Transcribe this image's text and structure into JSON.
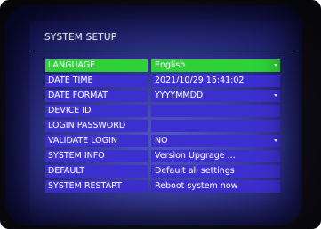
{
  "title": "SYSTEM SETUP",
  "colors": {
    "item_bg": "#3c2fd0",
    "active_bg": "#2fd236",
    "title_rule": "#a8e6df"
  },
  "rows": [
    {
      "label": "LANGUAGE",
      "value": "English",
      "dropdown": true,
      "active": true
    },
    {
      "label": "DATE TIME",
      "value": "2021/10/29 15:41:02",
      "dropdown": false
    },
    {
      "label": "DATE FORMAT",
      "value": "YYYYMMDD",
      "dropdown": true
    },
    {
      "label": "DEVICE ID",
      "value": "",
      "dropdown": false
    },
    {
      "label": "LOGIN PASSWORD",
      "value": "",
      "dropdown": false
    },
    {
      "label": "VALIDATE LOGIN",
      "value": "NO",
      "dropdown": true
    },
    {
      "label": "SYSTEM INFO",
      "value": "Version Upgrage ...",
      "dropdown": false
    },
    {
      "label": "DEFAULT",
      "value": "Default all settings",
      "dropdown": false
    },
    {
      "label": "SYSTEM RESTART",
      "value": "Reboot system now",
      "dropdown": false
    }
  ]
}
